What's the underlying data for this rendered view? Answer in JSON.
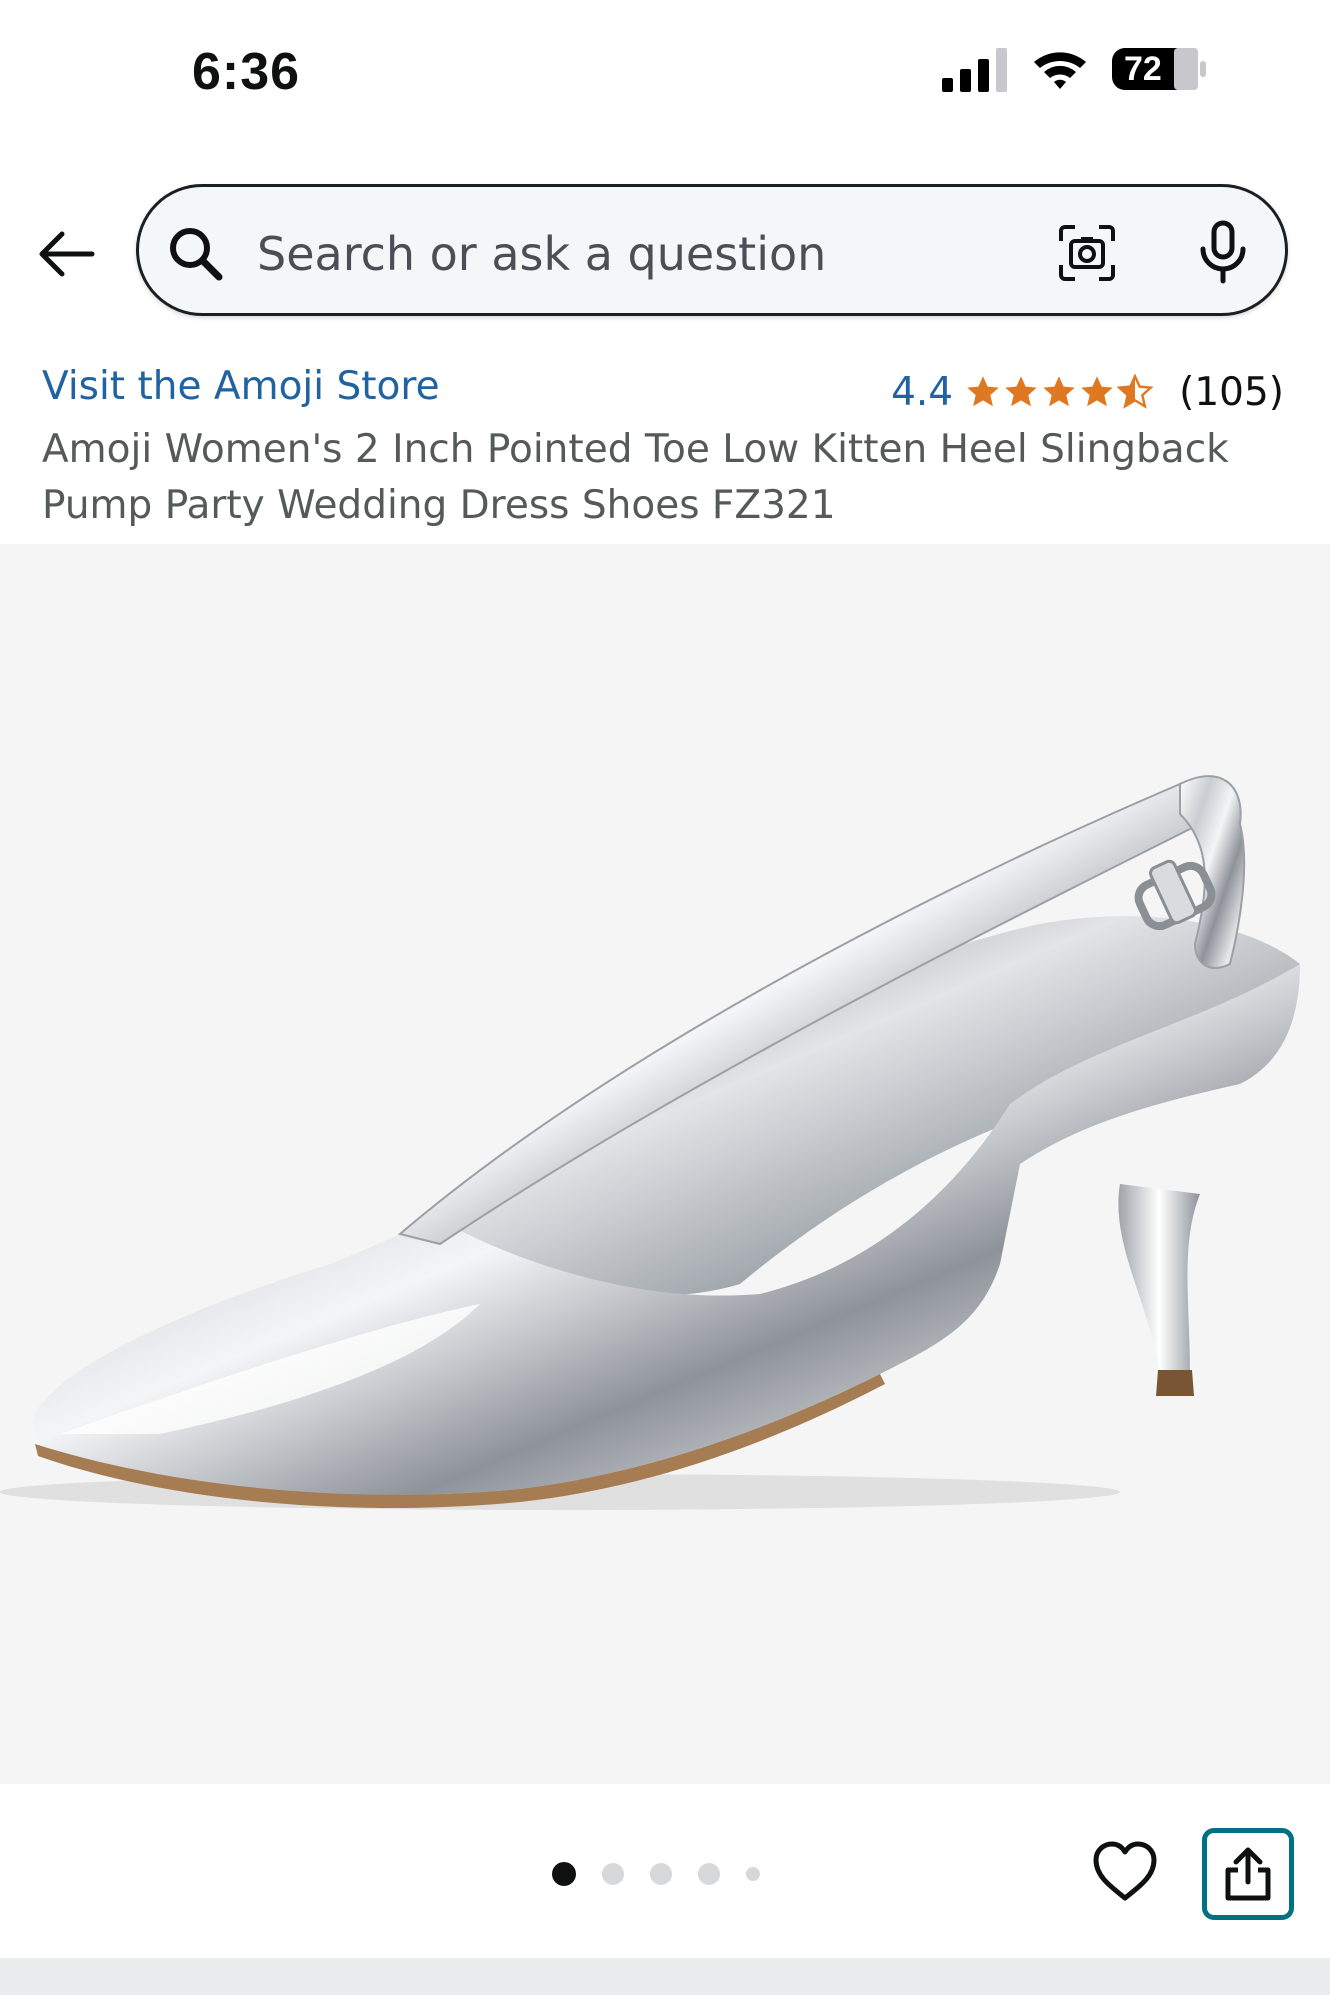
{
  "status": {
    "time": "6:36",
    "battery": "72"
  },
  "search": {
    "placeholder": "Search or ask a question"
  },
  "product": {
    "store_link": "Visit the Amoji Store",
    "rating": "4.4",
    "rating_fraction": 0.88,
    "review_count": "(105)",
    "title": "Amoji Women's 2 Inch Pointed Toe Low Kitten Heel Slingback Pump Party Wedding Dress Shoes FZ321"
  },
  "gallery": {
    "image_count": 5,
    "active_index": 0
  },
  "colors": {
    "link": "#2162a1",
    "star": "#de7921",
    "share_border": "#007185",
    "image_bg": "#f5f5f5"
  },
  "icons": [
    "back-arrow-icon",
    "search-icon",
    "camera-icon",
    "microphone-icon",
    "star-icon",
    "heart-icon",
    "share-icon",
    "signal-icon",
    "wifi-icon",
    "battery-icon"
  ]
}
